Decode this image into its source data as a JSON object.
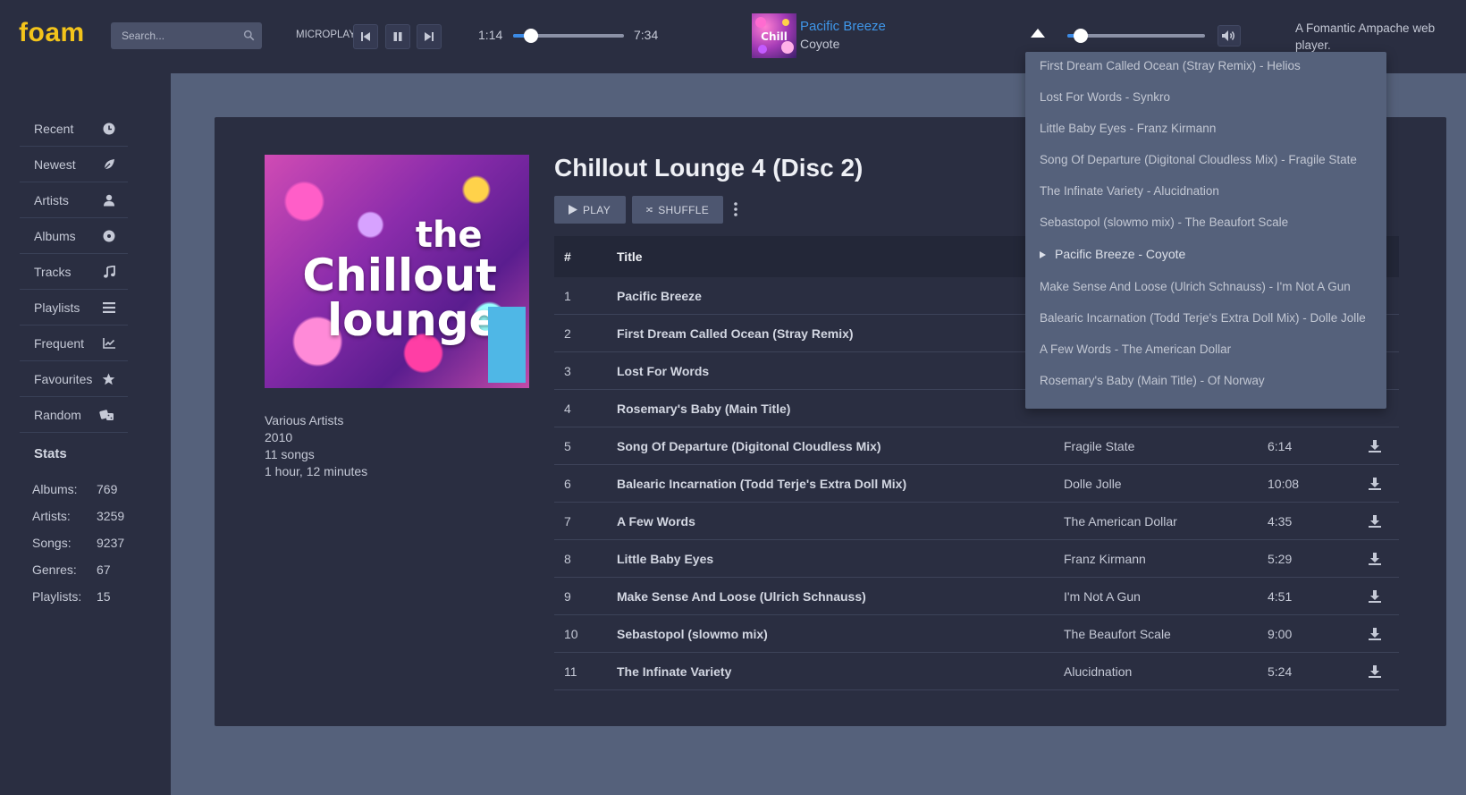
{
  "app": {
    "logo": "foam",
    "tagline": "A Fomantic Ampache web player."
  },
  "search": {
    "placeholder": "Search..."
  },
  "player": {
    "mode_label": "MICROPLAY",
    "elapsed": "1:14",
    "duration": "7:34",
    "progress_fraction": 0.16,
    "volume_fraction": 0.1,
    "now_playing": {
      "title": "Pacific Breeze",
      "artist": "Coyote"
    }
  },
  "sidebar": {
    "items": [
      {
        "label": "Recent",
        "icon": "clock-icon"
      },
      {
        "label": "Newest",
        "icon": "leaf-icon"
      },
      {
        "label": "Artists",
        "icon": "user-icon"
      },
      {
        "label": "Albums",
        "icon": "disc-icon"
      },
      {
        "label": "Tracks",
        "icon": "music-note-icon"
      },
      {
        "label": "Playlists",
        "icon": "list-icon"
      },
      {
        "label": "Frequent",
        "icon": "chart-icon"
      },
      {
        "label": "Favourites",
        "icon": "star-icon"
      },
      {
        "label": "Random",
        "icon": "dice-icon"
      }
    ],
    "stats_title": "Stats",
    "stats": [
      {
        "label": "Albums:",
        "value": "769"
      },
      {
        "label": "Artists:",
        "value": "3259"
      },
      {
        "label": "Songs:",
        "value": "9237"
      },
      {
        "label": "Genres:",
        "value": "67"
      },
      {
        "label": "Playlists:",
        "value": "15"
      }
    ]
  },
  "album": {
    "title": "Chillout Lounge 4 (Disc 2)",
    "artist": "Various Artists",
    "year": "2010",
    "song_count": "11 songs",
    "length": "1 hour, 12 minutes",
    "cover_text": {
      "the": "the",
      "chillout": "Chillout",
      "lounge": "lounge"
    },
    "play_label": "PLAY",
    "shuffle_label": "SHUFFLE"
  },
  "table": {
    "headers": {
      "num": "#",
      "title": "Title"
    },
    "rows": [
      {
        "num": "1",
        "title": "Pacific Breeze",
        "artist": "",
        "time": ""
      },
      {
        "num": "2",
        "title": "First Dream Called Ocean (Stray Remix)",
        "artist": "",
        "time": ""
      },
      {
        "num": "3",
        "title": "Lost For Words",
        "artist": "",
        "time": ""
      },
      {
        "num": "4",
        "title": "Rosemary's Baby (Main Title)",
        "artist": "",
        "time": ""
      },
      {
        "num": "5",
        "title": "Song Of Departure (Digitonal Cloudless Mix)",
        "artist": "Fragile State",
        "time": "6:14"
      },
      {
        "num": "6",
        "title": "Balearic Incarnation (Todd Terje's Extra Doll Mix)",
        "artist": "Dolle Jolle",
        "time": "10:08"
      },
      {
        "num": "7",
        "title": "A Few Words",
        "artist": "The American Dollar",
        "time": "4:35"
      },
      {
        "num": "8",
        "title": "Little Baby Eyes",
        "artist": "Franz Kirmann",
        "time": "5:29"
      },
      {
        "num": "9",
        "title": "Make Sense And Loose (Ulrich Schnauss)",
        "artist": "I'm Not A Gun",
        "time": "4:51"
      },
      {
        "num": "10",
        "title": "Sebastopol (slowmo mix)",
        "artist": "The Beaufort Scale",
        "time": "9:00"
      },
      {
        "num": "11",
        "title": "The Infinate Variety",
        "artist": "Alucidnation",
        "time": "5:24"
      }
    ]
  },
  "queue": {
    "items": [
      {
        "label": "First Dream Called Ocean (Stray Remix) - Helios",
        "current": false
      },
      {
        "label": "Lost For Words - Synkro",
        "current": false
      },
      {
        "label": "Little Baby Eyes - Franz Kirmann",
        "current": false
      },
      {
        "label": "Song Of Departure (Digitonal Cloudless Mix) - Fragile State",
        "current": false
      },
      {
        "label": "The Infinate Variety - Alucidnation",
        "current": false
      },
      {
        "label": "Sebastopol (slowmo mix) - The Beaufort Scale",
        "current": false
      },
      {
        "label": "Pacific Breeze - Coyote",
        "current": true
      },
      {
        "label": "Make Sense And Loose (Ulrich Schnauss) - I'm Not A Gun",
        "current": false
      },
      {
        "label": "Balearic Incarnation (Todd Terje's Extra Doll Mix) - Dolle Jolle",
        "current": false
      },
      {
        "label": "A Few Words - The American Dollar",
        "current": false
      },
      {
        "label": "Rosemary's Baby (Main Title) - Of Norway",
        "current": false
      }
    ]
  },
  "colors": {
    "accent": "#3a8ae6",
    "logo": "#f3c41b",
    "link": "#3f96e8"
  }
}
